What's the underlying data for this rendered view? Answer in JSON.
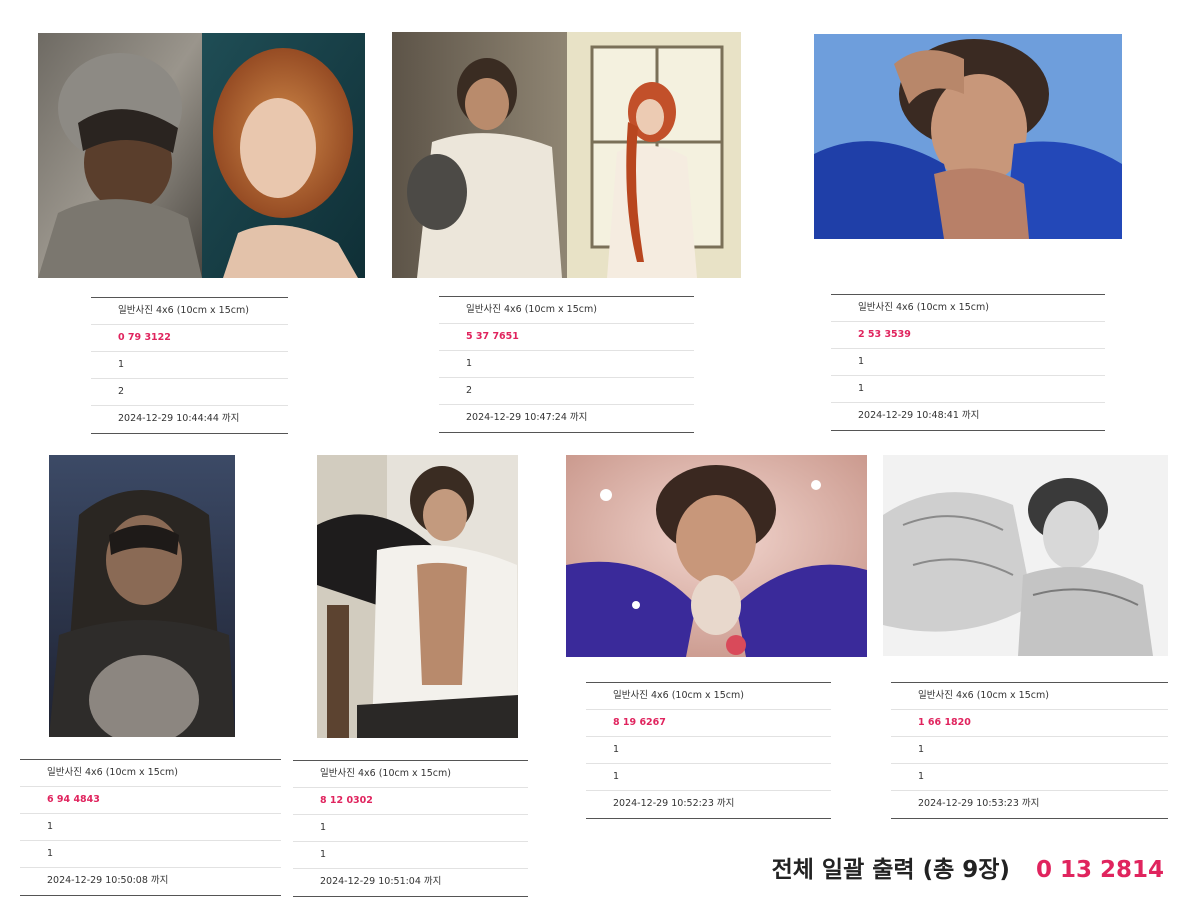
{
  "colors": {
    "code": "#e0245e",
    "text": "#333333",
    "rule": "#555555"
  },
  "items": [
    {
      "product": "일반사진 4x6 (10cm x 15cm)",
      "code": "0 79 3122",
      "qty1": "1",
      "qty2": "2",
      "deadline": "2024-12-29 10:44:44 까지",
      "image": "knight-and-redhead-illustration"
    },
    {
      "product": "일반사진 4x6 (10cm x 15cm)",
      "code": "5 37 7651",
      "qty1": "1",
      "qty2": "2",
      "deadline": "2024-12-29 10:47:24 까지",
      "image": "man-and-woman-by-window-illustration"
    },
    {
      "product": "일반사진 4x6 (10cm x 15cm)",
      "code": "2 53 3539",
      "qty1": "1",
      "qty2": "1",
      "deadline": "2024-12-29 10:48:41 까지",
      "image": "man-in-blue-robe-illustration"
    },
    {
      "product": "일반사진 4x6 (10cm x 15cm)",
      "code": "6 94 4843",
      "qty1": "1",
      "qty2": "1",
      "deadline": "2024-12-29 10:50:08 까지",
      "image": "hooded-knight-illustration"
    },
    {
      "product": "일반사진 4x6 (10cm x 15cm)",
      "code": "8 12 0302",
      "qty1": "1",
      "qty2": "1",
      "deadline": "2024-12-29 10:51:04 까지",
      "image": "man-on-chair-illustration"
    },
    {
      "product": "일반사진 4x6 (10cm x 15cm)",
      "code": "8 19 6267",
      "qty1": "1",
      "qty2": "1",
      "deadline": "2024-12-29 10:52:23 까지",
      "image": "man-with-petals-illustration"
    },
    {
      "product": "일반사진 4x6 (10cm x 15cm)",
      "code": "1 66 1820",
      "qty1": "1",
      "qty2": "1",
      "deadline": "2024-12-29 10:53:23 까지",
      "image": "man-and-horse-sketch"
    }
  ],
  "total": {
    "label": "전체 일괄 출력 (총 9장)",
    "amount": "0 13 2814"
  }
}
